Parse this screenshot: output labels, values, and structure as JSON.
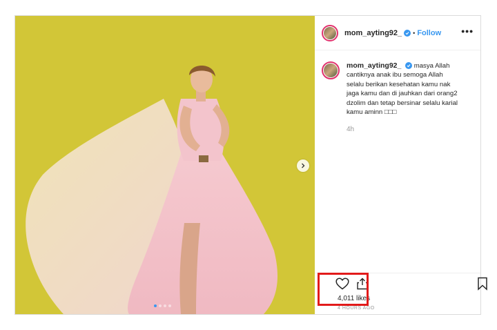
{
  "post": {
    "username": "mom_ayting92_",
    "follow_label": "Follow",
    "bullet": "•",
    "more_label": "•••",
    "caption_lines": [
      "masya Allah",
      "cantiknya anak ibu semoga Allah",
      "selalu berikan kesehatan kamu nak",
      "jaga kamu dan di jauhkan dari orang2",
      "dzolim dan tetap bersinar selalu karial",
      "kamu aminn □□□"
    ],
    "comment_age": "4h",
    "likes": "4,011 likes",
    "posted_ago": "4 HOURS AGO"
  },
  "colors": {
    "photo_background": "#d2c637",
    "link": "#3897f0",
    "highlight": "#e21a1a"
  },
  "icons": [
    "heart-icon",
    "share-icon",
    "bookmark-icon",
    "chevron-right-icon",
    "verified-badge-icon"
  ]
}
